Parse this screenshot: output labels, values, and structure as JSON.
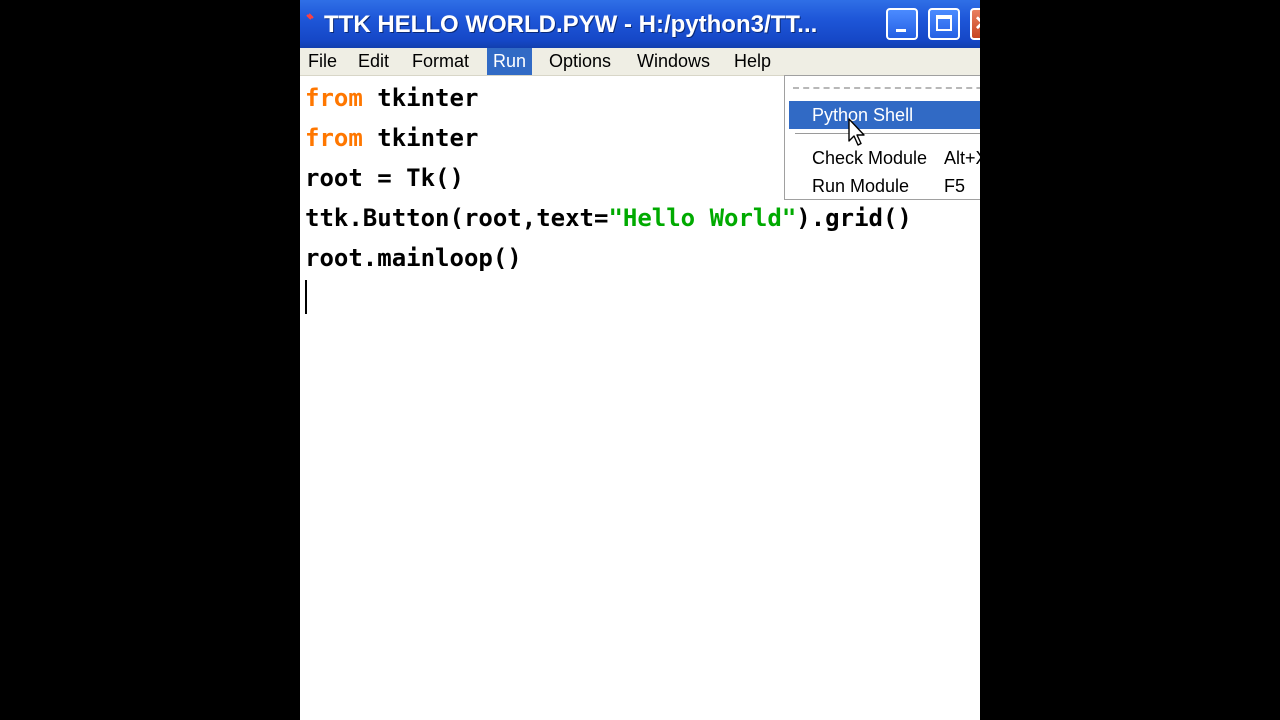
{
  "window": {
    "title": "TTK HELLO WORLD.PYW - H:/python3/TT..."
  },
  "titlebar_buttons": {
    "minimize_icon": "minimize-icon",
    "maximize_icon": "maximize-icon",
    "close_icon": "close-icon",
    "close_glyph": "✕"
  },
  "menubar": {
    "items": [
      {
        "label": "File"
      },
      {
        "label": "Edit"
      },
      {
        "label": "Format"
      },
      {
        "label": "Run",
        "active": true
      },
      {
        "label": "Options"
      },
      {
        "label": "Windows"
      },
      {
        "label": "Help"
      }
    ]
  },
  "run_menu": {
    "items": [
      {
        "label": "Python Shell",
        "accel": "",
        "selected": true
      },
      {
        "label": "Check Module",
        "accel": "Alt+X"
      },
      {
        "label": "Run Module",
        "accel": "F5"
      }
    ]
  },
  "code": {
    "line1": {
      "kw": "from",
      "rest": " tkinter"
    },
    "line2": {
      "kw": "from",
      "rest": " tkinter"
    },
    "line3": "root = Tk()",
    "line4": {
      "pre": "ttk.Button(root,text=",
      "str": "\"Hello World\"",
      "post": ").grid()"
    },
    "line5": "root.mainloop()"
  },
  "colors": {
    "titlebar": "#1e56d8",
    "menu_highlight": "#316ac5",
    "keyword": "#ff7700",
    "string": "#00aa00"
  }
}
